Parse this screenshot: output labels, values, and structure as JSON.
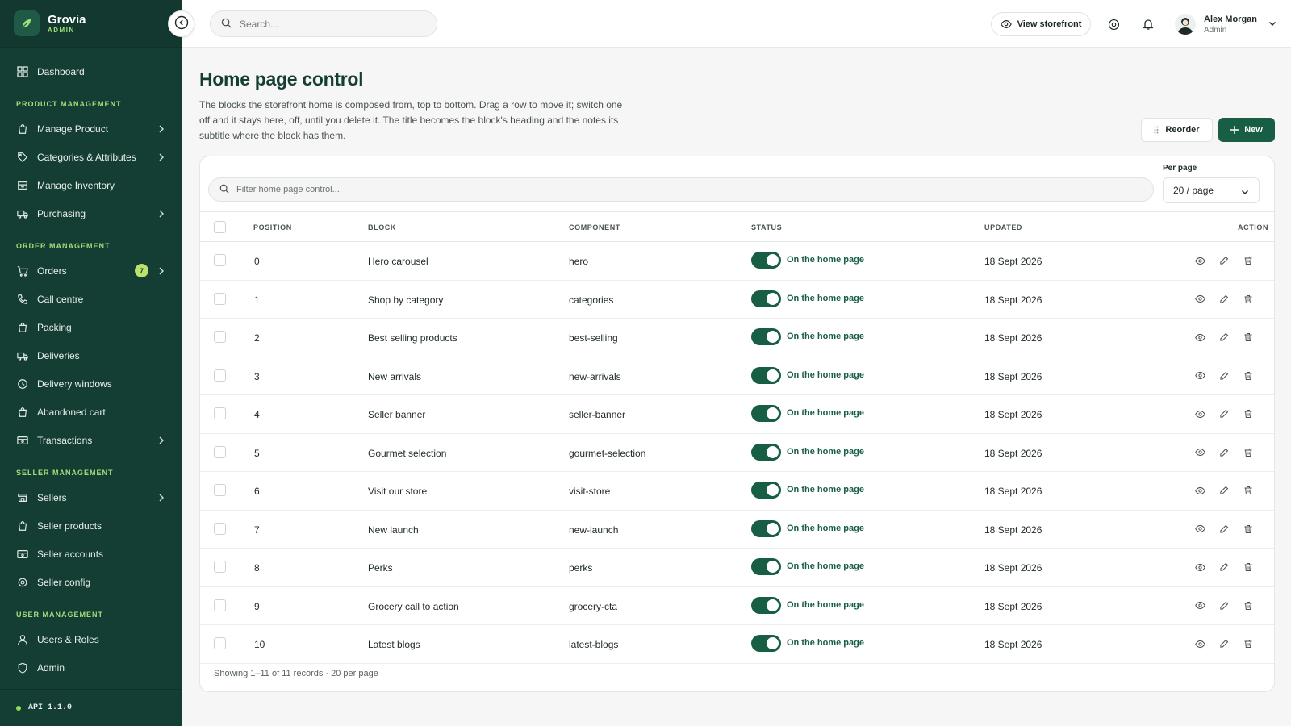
{
  "brand": {
    "name": "Grovia",
    "sub": "ADMIN"
  },
  "sidebar": {
    "dashboard": "Dashboard",
    "sections": [
      {
        "title": "PRODUCT MANAGEMENT",
        "items": [
          {
            "label": "Manage Product",
            "icon": "bag-icon",
            "chevron": true
          },
          {
            "label": "Categories & Attributes",
            "icon": "tag-icon",
            "chevron": true
          },
          {
            "label": "Manage Inventory",
            "icon": "inventory-icon",
            "chevron": false
          },
          {
            "label": "Purchasing",
            "icon": "truck-icon",
            "chevron": true
          }
        ]
      },
      {
        "title": "ORDER MANAGEMENT",
        "items": [
          {
            "label": "Orders",
            "icon": "cart-icon",
            "chevron": true,
            "badge": "7"
          },
          {
            "label": "Call centre",
            "icon": "phone-icon",
            "chevron": false
          },
          {
            "label": "Packing",
            "icon": "bag-icon",
            "chevron": false
          },
          {
            "label": "Deliveries",
            "icon": "truck-icon",
            "chevron": false
          },
          {
            "label": "Delivery windows",
            "icon": "clock-icon",
            "chevron": false
          },
          {
            "label": "Abandoned cart",
            "icon": "bag-icon",
            "chevron": false
          },
          {
            "label": "Transactions",
            "icon": "card-icon",
            "chevron": true
          }
        ]
      },
      {
        "title": "SELLER MANAGEMENT",
        "items": [
          {
            "label": "Sellers",
            "icon": "store-icon",
            "chevron": true
          },
          {
            "label": "Seller products",
            "icon": "bag-icon",
            "chevron": false
          },
          {
            "label": "Seller accounts",
            "icon": "card-icon",
            "chevron": false
          },
          {
            "label": "Seller config",
            "icon": "gear-icon",
            "chevron": false
          }
        ]
      },
      {
        "title": "USER MANAGEMENT",
        "items": [
          {
            "label": "Users & Roles",
            "icon": "user-icon",
            "chevron": false
          },
          {
            "label": "Admin",
            "icon": "shield-icon",
            "chevron": false
          }
        ]
      }
    ],
    "api_version": "API 1.1.0"
  },
  "topbar": {
    "search_placeholder": "Search...",
    "view_storefront": "View storefront",
    "user": {
      "name": "Alex Morgan",
      "role": "Admin"
    }
  },
  "page": {
    "title": "Home page control",
    "description": "The blocks the storefront home is composed from, top to bottom. Drag a row to move it; switch one off and it stays here, off, until you delete it. The title becomes the block's heading and the notes its subtitle where the block has them.",
    "reorder_label": "Reorder",
    "new_label": "New",
    "filter_placeholder": "Filter home page control...",
    "per_page_label": "Per page",
    "per_page_value": "20 / page",
    "columns": {
      "position": "POSITION",
      "block": "BLOCK",
      "component": "COMPONENT",
      "status": "STATUS",
      "updated": "UPDATED",
      "action": "ACTION"
    },
    "rows": [
      {
        "position": "0",
        "block": "Hero carousel",
        "component": "hero",
        "status": "On the home page",
        "enabled": true,
        "updated": "18 Sept 2026"
      },
      {
        "position": "1",
        "block": "Shop by category",
        "component": "categories",
        "status": "On the home page",
        "enabled": true,
        "updated": "18 Sept 2026"
      },
      {
        "position": "2",
        "block": "Best selling products",
        "component": "best-selling",
        "status": "On the home page",
        "enabled": true,
        "updated": "18 Sept 2026"
      },
      {
        "position": "3",
        "block": "New arrivals",
        "component": "new-arrivals",
        "status": "On the home page",
        "enabled": true,
        "updated": "18 Sept 2026"
      },
      {
        "position": "4",
        "block": "Seller banner",
        "component": "seller-banner",
        "status": "On the home page",
        "enabled": true,
        "updated": "18 Sept 2026"
      },
      {
        "position": "5",
        "block": "Gourmet selection",
        "component": "gourmet-selection",
        "status": "On the home page",
        "enabled": true,
        "updated": "18 Sept 2026"
      },
      {
        "position": "6",
        "block": "Visit our store",
        "component": "visit-store",
        "status": "On the home page",
        "enabled": true,
        "updated": "18 Sept 2026"
      },
      {
        "position": "7",
        "block": "New launch",
        "component": "new-launch",
        "status": "On the home page",
        "enabled": true,
        "updated": "18 Sept 2026"
      },
      {
        "position": "8",
        "block": "Perks",
        "component": "perks",
        "status": "On the home page",
        "enabled": true,
        "updated": "18 Sept 2026"
      },
      {
        "position": "9",
        "block": "Grocery call to action",
        "component": "grocery-cta",
        "status": "On the home page",
        "enabled": true,
        "updated": "18 Sept 2026"
      },
      {
        "position": "10",
        "block": "Latest blogs",
        "component": "latest-blogs",
        "status": "On the home page",
        "enabled": true,
        "updated": "18 Sept 2026"
      }
    ],
    "footer": "Showing 1–11 of 11 records · 20 per page"
  },
  "colors": {
    "sidebar": "#143d33",
    "accent": "#175e45",
    "section_label": "#9fe07a",
    "badge": "#b9e36b"
  }
}
